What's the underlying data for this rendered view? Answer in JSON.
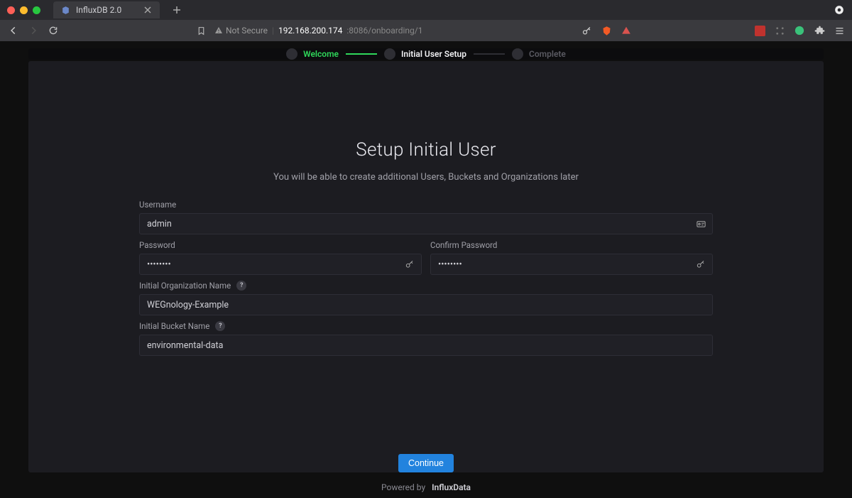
{
  "browser": {
    "tab_title": "InfluxDB 2.0",
    "not_secure_label": "Not Secure",
    "url_host": "192.168.200.174",
    "url_port_path": ":8086/onboarding/1"
  },
  "stepper": {
    "steps": [
      {
        "label": "Welcome",
        "state": "done"
      },
      {
        "label": "Initial User Setup",
        "state": "active"
      },
      {
        "label": "Complete",
        "state": "upcoming"
      }
    ]
  },
  "heading": {
    "title": "Setup Initial User",
    "subtitle": "You will be able to create additional Users, Buckets and Organizations later"
  },
  "form": {
    "username_label": "Username",
    "username_value": "admin",
    "password_label": "Password",
    "password_value": "••••••••",
    "confirm_label": "Confirm Password",
    "confirm_value": "••••••••",
    "org_label": "Initial Organization Name",
    "org_value": "WEGnology-Example",
    "bucket_label": "Initial Bucket Name",
    "bucket_value": "environmental-data",
    "continue_label": "Continue"
  },
  "footer": {
    "powered_by": "Powered by",
    "brand": "InfluxData"
  },
  "colors": {
    "accent_green": "#2fd75a",
    "accent_blue": "#2283de"
  }
}
